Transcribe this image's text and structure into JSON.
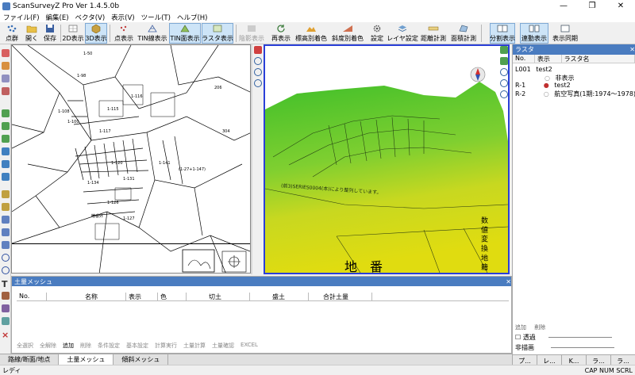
{
  "window": {
    "title": "ScanSurveyZ Pro  Ver 1.4.5.0b",
    "minimize": "—",
    "restore": "❐",
    "close": "✕"
  },
  "menu": {
    "file": "ファイル(F)",
    "edit": "編集(E)",
    "vector": "ベクタ(V)",
    "view": "表示(V)",
    "tools": "ツール(T)",
    "help": "ヘルプ(H)"
  },
  "toolbar": {
    "point_cloud": "点群",
    "open": "開く",
    "save": "保存",
    "view2d": "2D表示",
    "view3d": "3D表示",
    "point_display": "点表示",
    "tin_line": "TIN線表示",
    "tin_face": "TIN面表示",
    "raster_display": "ラスタ表示",
    "hidden_surface": "陰影表示",
    "redisplay": "再表示",
    "elevation_color": "標高別着色",
    "slope_color": "斜度別着色",
    "settings": "設定",
    "layer_settings": "レイヤ設定",
    "distance_measure": "距離計測",
    "area_measure": "面積計測",
    "split_view": "分割表示",
    "linked_view": "連動表示",
    "view_sync": "表示同期"
  },
  "map2d": {
    "lot_labels": [
      "1-98",
      "1-50",
      "1-108",
      "1-100",
      "1-115",
      "1-116",
      "1-117",
      "1-120",
      "1-131",
      "1-134",
      "1-141",
      "1-126",
      "1-127",
      "206",
      "304",
      "地番外",
      "(1-27+1-147)"
    ]
  },
  "view3d": {
    "lot_text": "地　番",
    "banner_text": "(前3)SERIES0004(本)により整列しています。",
    "side_text": "数 値 変 換 地 籍 図"
  },
  "raster_panel": {
    "title": "ラスタ",
    "col_no": "No.",
    "col_display": "表示",
    "col_name": "ラスタ名",
    "rows": [
      {
        "no": "L001",
        "display": "test2",
        "name": ""
      },
      {
        "no": "",
        "display": "非表示",
        "name": ""
      },
      {
        "no": "R-1",
        "display": "test2",
        "name": ""
      },
      {
        "no": "R-2",
        "display": "航空写真(1期:1974〜1978):",
        "name": ""
      }
    ],
    "add_label": "追加",
    "delete_label": "削除",
    "transparent_label": "透過",
    "hidden_label": "非描画",
    "tabs": [
      "プ...",
      "レ...",
      "K...",
      "ラ...",
      "ラ..."
    ]
  },
  "earth_panel": {
    "title": "土量メッシュ",
    "cols": [
      "No.",
      "名称",
      "表示",
      "色",
      "切土",
      "盛土",
      "合計土量"
    ],
    "actions": [
      "全選択",
      "全解除",
      "追加",
      "削除",
      "条件設定",
      "基本設定",
      "計算実行",
      "土量計算",
      "土量確認",
      "EXCEL"
    ]
  },
  "bottom_tabs": {
    "route": "路線/断面/地点",
    "earth": "土量メッシュ",
    "slope": "傾斜メッシュ"
  },
  "status": {
    "ready": "レディ",
    "indicators": "CAP NUM SCRL"
  },
  "colors": {
    "accent": "#4a7cc0",
    "active_button": "#cde4f7",
    "view3d_border": "#2a3fd8"
  }
}
